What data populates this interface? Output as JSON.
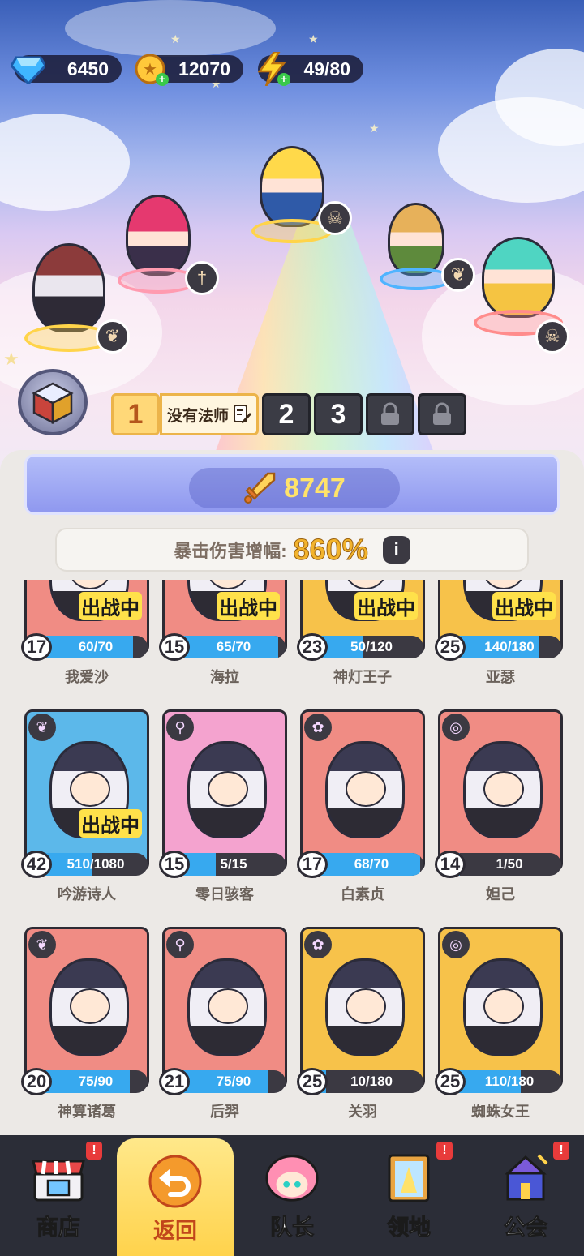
{
  "resources": {
    "gems": "6450",
    "gold": "12070",
    "energy": "49/80"
  },
  "team": {
    "slots": [
      "1",
      "2",
      "3"
    ],
    "active_team_name": "没有法师"
  },
  "power": "8747",
  "crit": {
    "label": "暴击伤害增幅:",
    "value": "860%"
  },
  "deployed_label": "出战中",
  "heroes": [
    {
      "name": "我爱沙",
      "level": "17",
      "fragments": "60/70",
      "progress": 0.86,
      "deployed": true,
      "color": "#f08c84"
    },
    {
      "name": "海拉",
      "level": "15",
      "fragments": "65/70",
      "progress": 0.93,
      "deployed": true,
      "color": "#f08c84"
    },
    {
      "name": "神灯王子",
      "level": "23",
      "fragments": "50/120",
      "progress": 0.42,
      "deployed": true,
      "color": "#f7c24a"
    },
    {
      "name": "亚瑟",
      "level": "25",
      "fragments": "140/180",
      "progress": 0.78,
      "deployed": true,
      "color": "#f7c24a"
    },
    {
      "name": "吟游诗人",
      "level": "42",
      "fragments": "510/1080",
      "progress": 0.47,
      "deployed": true,
      "color": "#5cb8ea"
    },
    {
      "name": "零日骇客",
      "level": "15",
      "fragments": "5/15",
      "progress": 0.33,
      "deployed": false,
      "color": "#f4a3cf"
    },
    {
      "name": "白素贞",
      "level": "17",
      "fragments": "68/70",
      "progress": 0.97,
      "deployed": false,
      "color": "#f08c84"
    },
    {
      "name": "妲己",
      "level": "14",
      "fragments": "1/50",
      "progress": 0.02,
      "deployed": false,
      "color": "#f08c84"
    },
    {
      "name": "神算诸葛",
      "level": "20",
      "fragments": "75/90",
      "progress": 0.83,
      "deployed": false,
      "color": "#f08c84"
    },
    {
      "name": "后羿",
      "level": "21",
      "fragments": "75/90",
      "progress": 0.83,
      "deployed": false,
      "color": "#f08c84"
    },
    {
      "name": "关羽",
      "level": "25",
      "fragments": "10/180",
      "progress": 0.06,
      "deployed": false,
      "color": "#f7c24a"
    },
    {
      "name": "蜘蛛女王",
      "level": "25",
      "fragments": "110/180",
      "progress": 0.61,
      "deployed": false,
      "color": "#f7c24a"
    }
  ],
  "nav": {
    "shop": "商店",
    "back": "返回",
    "captain": "队长",
    "territory": "领地",
    "guild": "公会",
    "alert_mark": "!"
  }
}
